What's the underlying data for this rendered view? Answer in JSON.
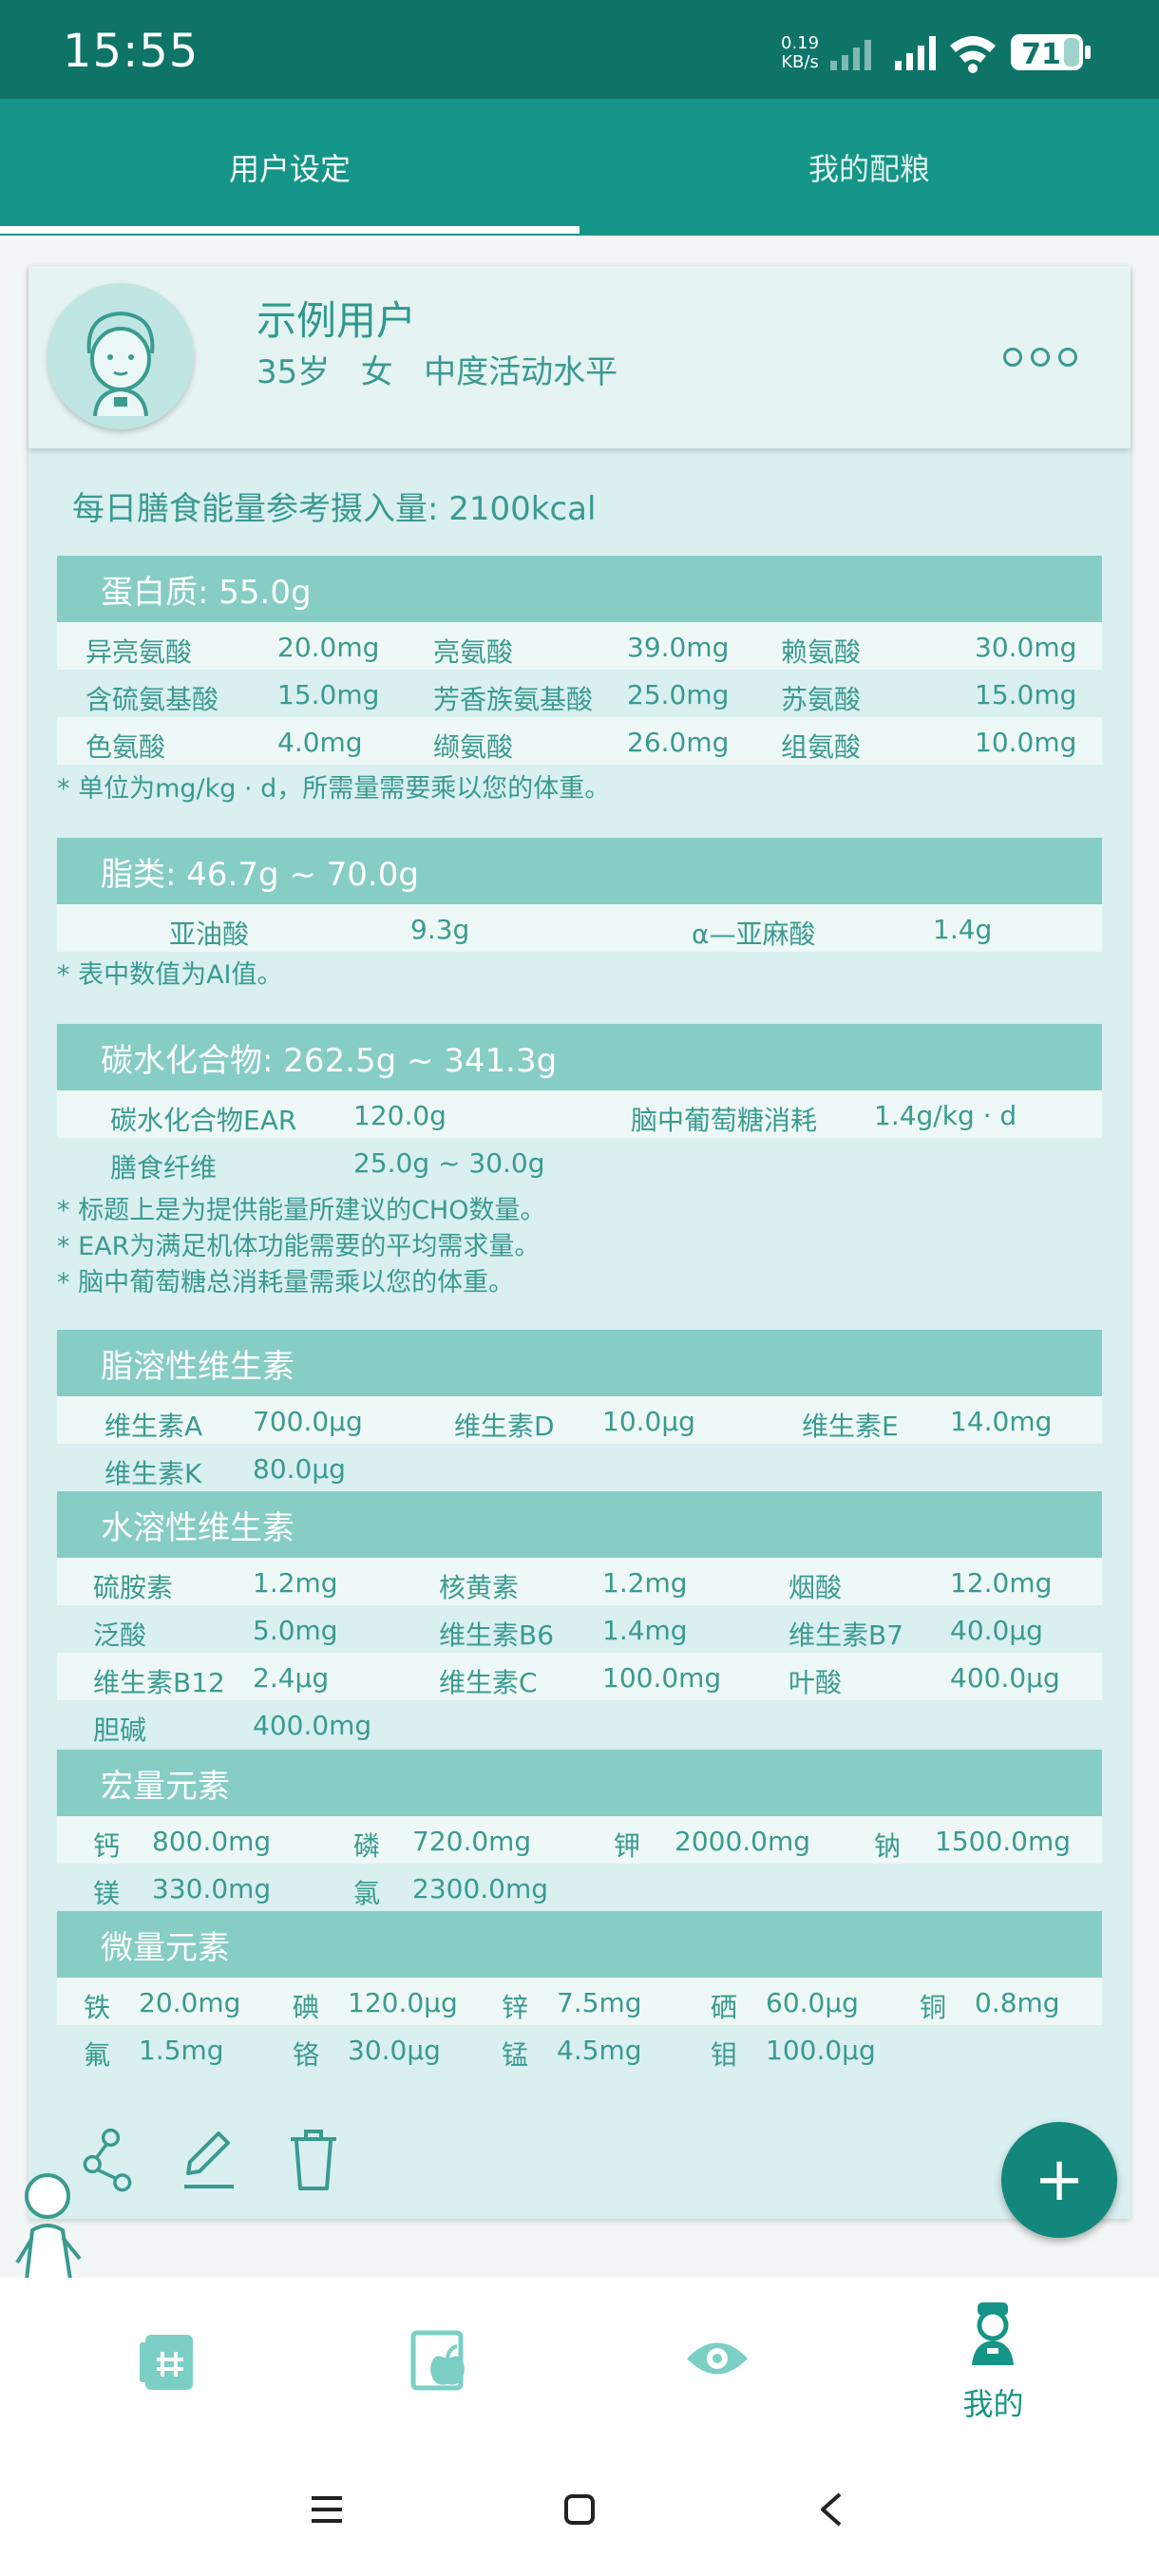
{
  "status_bar": {
    "time": "15:55",
    "speed_value": "0.19",
    "speed_unit": "KB/s",
    "battery": "71"
  },
  "tabs": [
    {
      "label": "用户设定",
      "active": true
    },
    {
      "label": "我的配粮",
      "active": false
    }
  ],
  "profile": {
    "name": "示例用户",
    "age": "35岁",
    "gender": "女",
    "activity": "中度活动水平"
  },
  "energy": "每日膳食能量参考摄入量: 2100kcal",
  "protein": {
    "title": "蛋白质: 55.0g",
    "rows": [
      [
        {
          "name": "异亮氨酸",
          "value": "20.0mg"
        },
        {
          "name": "亮氨酸",
          "value": "39.0mg"
        },
        {
          "name": "赖氨酸",
          "value": "30.0mg"
        }
      ],
      [
        {
          "name": "含硫氨基酸",
          "value": "15.0mg"
        },
        {
          "name": "芳香族氨基酸",
          "value": "25.0mg"
        },
        {
          "name": "苏氨酸",
          "value": "15.0mg"
        }
      ],
      [
        {
          "name": "色氨酸",
          "value": "4.0mg"
        },
        {
          "name": "缬氨酸",
          "value": "26.0mg"
        },
        {
          "name": "组氨酸",
          "value": "10.0mg"
        }
      ]
    ],
    "note": "* 单位为mg/kg · d，所需量需要乘以您的体重。"
  },
  "fat": {
    "title": "脂类: 46.7g ~ 70.0g",
    "rows": [
      [
        {
          "name": "亚油酸",
          "value": "9.3g"
        },
        {
          "name": "α—亚麻酸",
          "value": "1.4g"
        }
      ]
    ],
    "note": "* 表中数值为AI值。"
  },
  "carb": {
    "title": "碳水化合物: 262.5g ~ 341.3g",
    "rows": [
      [
        {
          "name": "碳水化合物EAR",
          "value": "120.0g"
        },
        {
          "name": "脑中葡萄糖消耗",
          "value": "1.4g/kg · d"
        }
      ],
      [
        {
          "name": "膳食纤维",
          "value": "25.0g ~ 30.0g"
        }
      ]
    ],
    "notes": [
      "* 标题上是为提供能量所建议的CHO数量。",
      "* EAR为满足机体功能需要的平均需求量。",
      "* 脑中葡萄糖总消耗量需乘以您的体重。"
    ]
  },
  "fat_vitamins": {
    "title": "脂溶性维生素",
    "rows": [
      [
        {
          "name": "维生素A",
          "value": "700.0μg"
        },
        {
          "name": "维生素D",
          "value": "10.0μg"
        },
        {
          "name": "维生素E",
          "value": "14.0mg"
        }
      ],
      [
        {
          "name": "维生素K",
          "value": "80.0μg"
        }
      ]
    ]
  },
  "water_vitamins": {
    "title": "水溶性维生素",
    "rows": [
      [
        {
          "name": "硫胺素",
          "value": "1.2mg"
        },
        {
          "name": "核黄素",
          "value": "1.2mg"
        },
        {
          "name": "烟酸",
          "value": "12.0mg"
        }
      ],
      [
        {
          "name": "泛酸",
          "value": "5.0mg"
        },
        {
          "name": "维生素B6",
          "value": "1.4mg"
        },
        {
          "name": "维生素B7",
          "value": "40.0μg"
        }
      ],
      [
        {
          "name": "维生素B12",
          "value": "2.4μg"
        },
        {
          "name": "维生素C",
          "value": "100.0mg"
        },
        {
          "name": "叶酸",
          "value": "400.0μg"
        }
      ],
      [
        {
          "name": "胆碱",
          "value": "400.0mg"
        }
      ]
    ]
  },
  "macro": {
    "title": "宏量元素",
    "rows": [
      [
        {
          "name": "钙",
          "value": "800.0mg"
        },
        {
          "name": "磷",
          "value": "720.0mg"
        },
        {
          "name": "钾",
          "value": "2000.0mg"
        },
        {
          "name": "钠",
          "value": "1500.0mg"
        }
      ],
      [
        {
          "name": "镁",
          "value": "330.0mg"
        },
        {
          "name": "氯",
          "value": "2300.0mg"
        }
      ]
    ]
  },
  "micro": {
    "title": "微量元素",
    "rows": [
      [
        {
          "name": "铁",
          "value": "20.0mg"
        },
        {
          "name": "碘",
          "value": "120.0μg"
        },
        {
          "name": "锌",
          "value": "7.5mg"
        },
        {
          "name": "硒",
          "value": "60.0μg"
        },
        {
          "name": "铜",
          "value": "0.8mg"
        }
      ],
      [
        {
          "name": "氟",
          "value": "1.5mg"
        },
        {
          "name": "铬",
          "value": "30.0μg"
        },
        {
          "name": "锰",
          "value": "4.5mg"
        },
        {
          "name": "钼",
          "value": "100.0μg"
        }
      ]
    ]
  },
  "fab": {
    "label": "+"
  },
  "bottom_nav": [
    {
      "icon": "calculator-icon",
      "label": ""
    },
    {
      "icon": "food-apple-icon",
      "label": ""
    },
    {
      "icon": "eye-icon",
      "label": ""
    },
    {
      "icon": "user-doctor-icon",
      "label": "我的"
    }
  ],
  "colors": {
    "primary": "#159587",
    "dark": "#0e7468",
    "section": "#86cdc4",
    "card": "#d9eff0",
    "text": "#3a9b8f"
  }
}
